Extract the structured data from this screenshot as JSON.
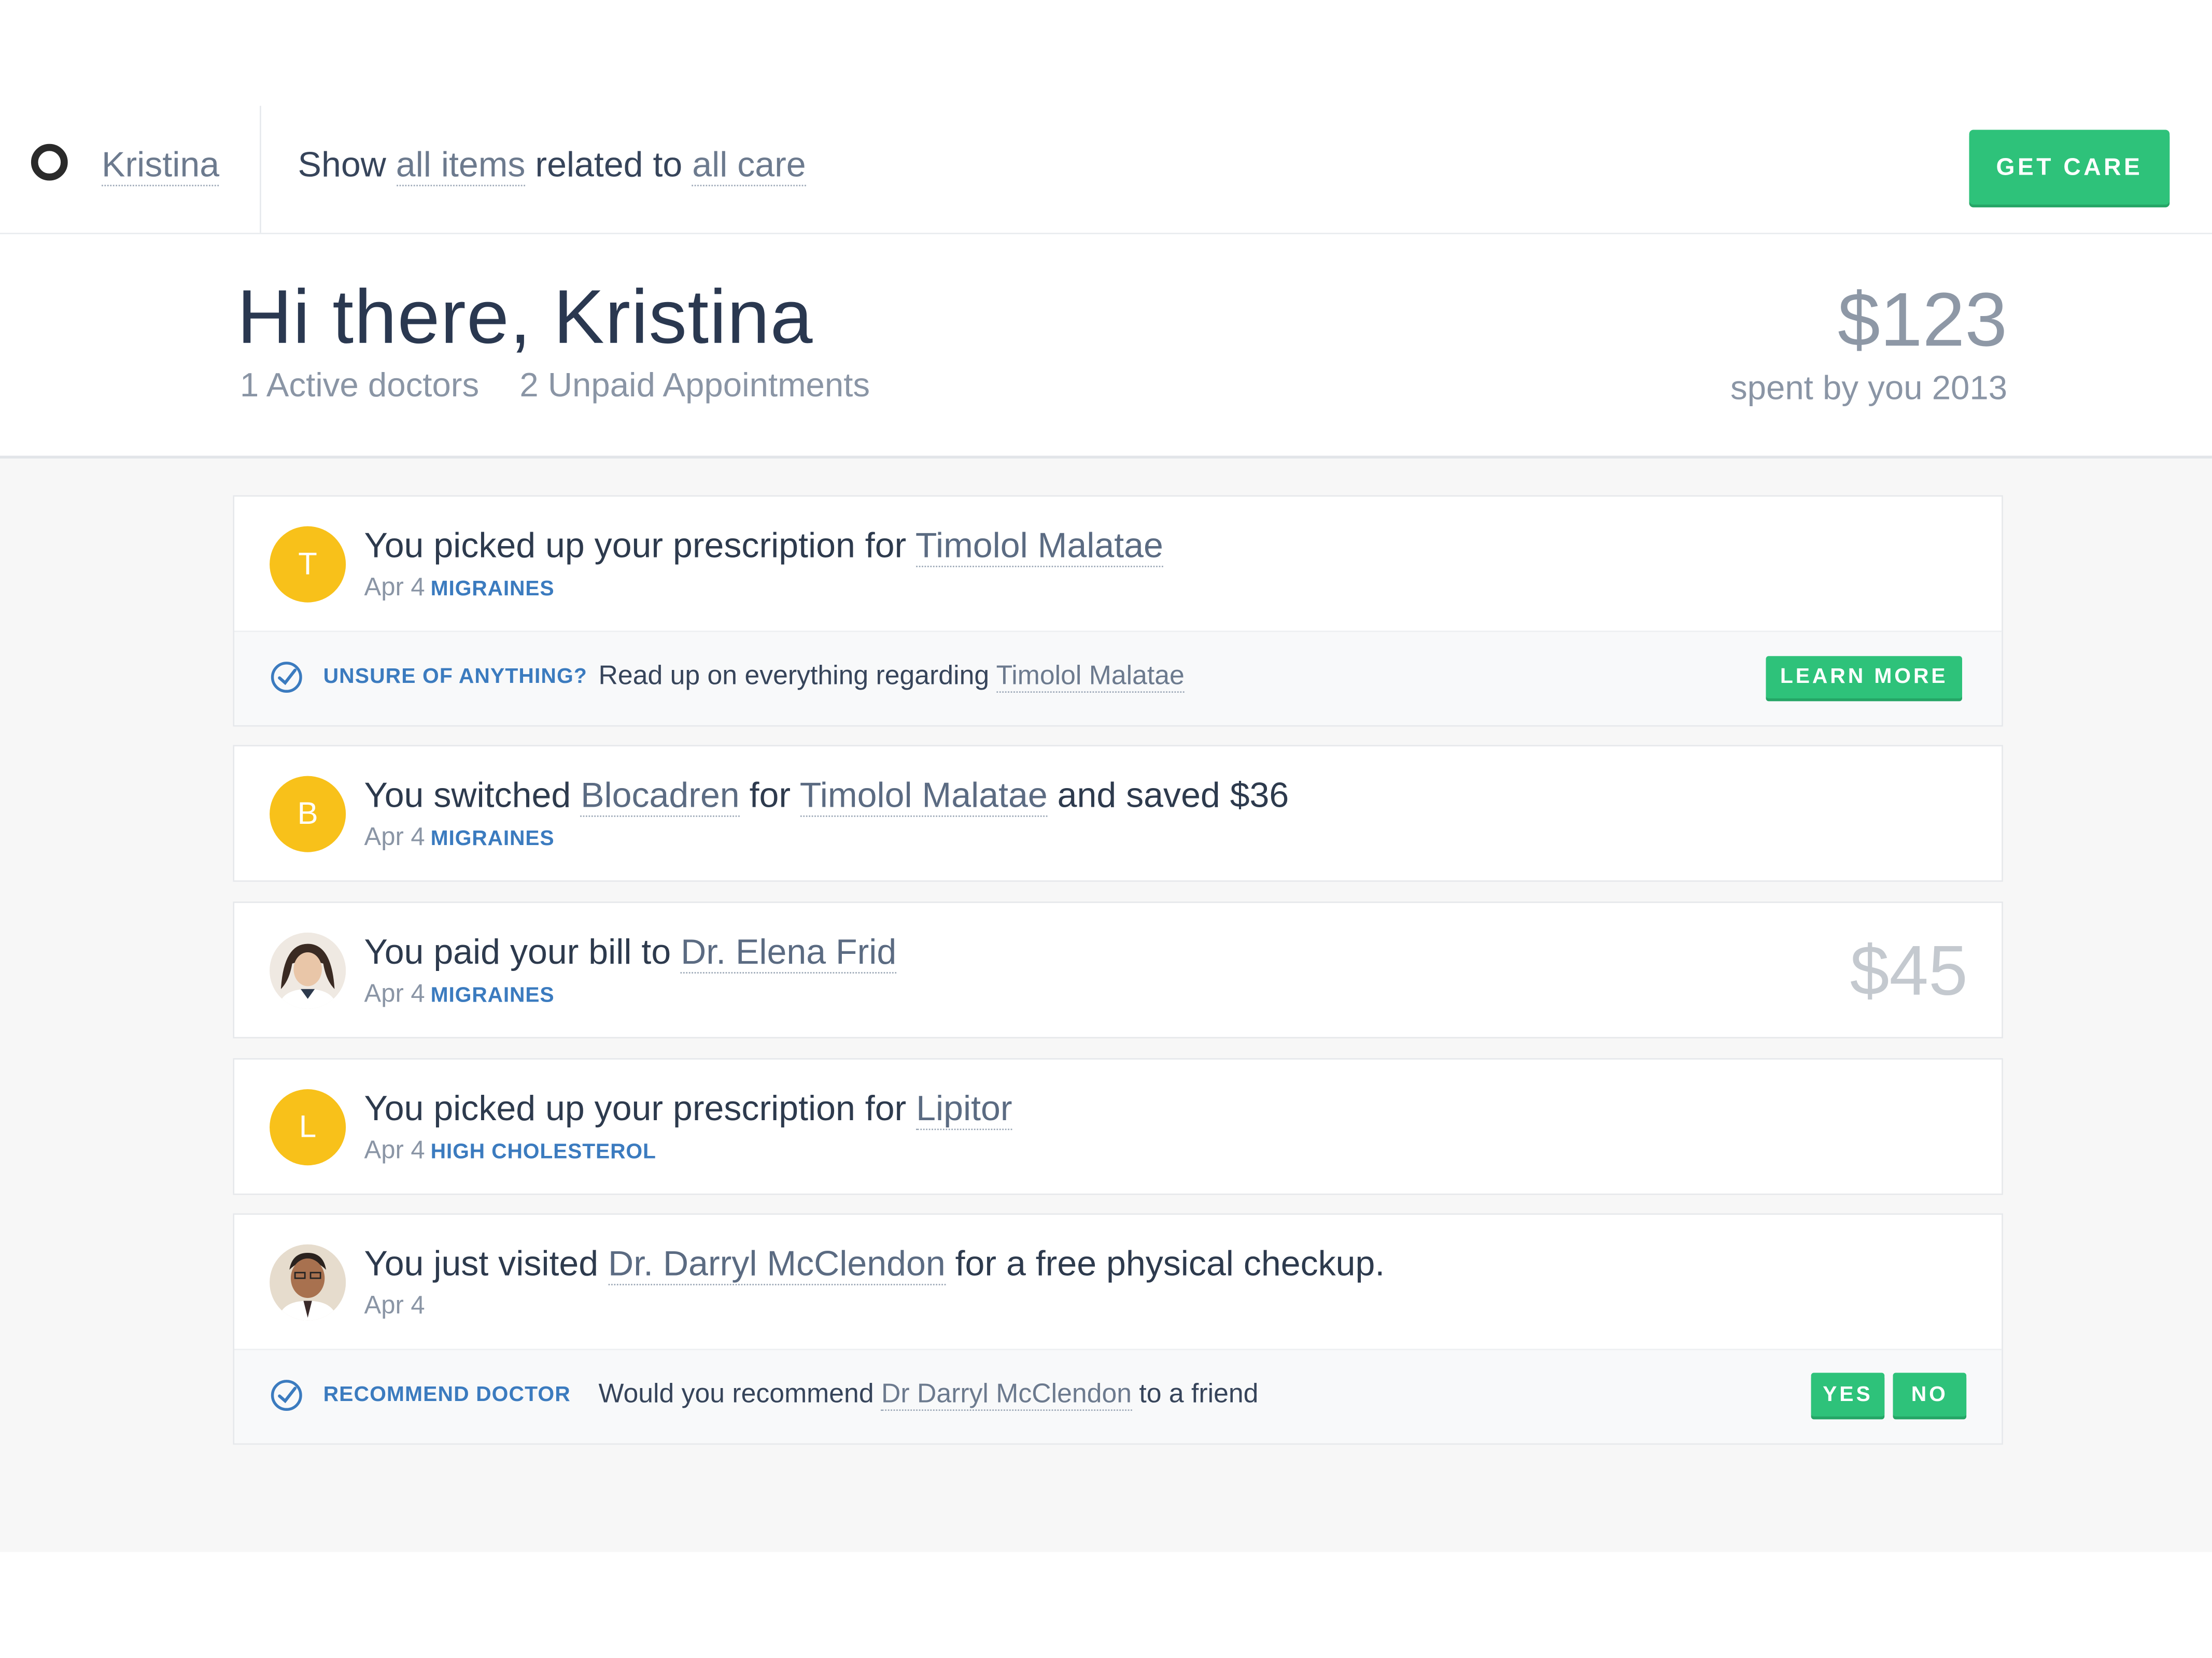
{
  "topbar": {
    "user_name": "Kristina",
    "filter": {
      "prefix": "Show",
      "items_link": "all items",
      "middle": "related to",
      "care_link": "all care"
    },
    "cta_label": "GET CARE"
  },
  "hero": {
    "greeting": "Hi there, Kristina",
    "active_doctors": "1 Active doctors",
    "unpaid": "2 Unpaid Appointments",
    "amount": "$123",
    "amount_caption": "spent by you 2013"
  },
  "feed": [
    {
      "avatar_letter": "T",
      "prefix": "You picked up your prescription for ",
      "link": "Timolol Malatae",
      "date": "Apr 4",
      "tag": "MIGRAINES",
      "footer": {
        "label": "UNSURE OF ANYTHING?",
        "text": "Read up on everything regarding ",
        "link": "Timolol Malatae",
        "button": "LEARN MORE"
      }
    },
    {
      "avatar_letter": "B",
      "prefix": "You switched ",
      "link1": "Blocadren",
      "middle": " for ",
      "link2": "Timolol Malatae",
      "suffix": " and saved $36",
      "date": "Apr 4",
      "tag": "MIGRAINES"
    },
    {
      "prefix": "You paid your bill to ",
      "link": "Dr. Elena Frid",
      "date": "Apr 4",
      "tag": "MIGRAINES",
      "amount": "$45"
    },
    {
      "avatar_letter": "L",
      "prefix": "You picked up your prescription for ",
      "link": "Lipitor",
      "date": "Apr 4",
      "tag": "HIGH CHOLESTEROL"
    },
    {
      "prefix": "You just visited ",
      "link": "Dr. Darryl McClendon",
      "suffix": " for a free physical checkup.",
      "date": "Apr 4",
      "footer": {
        "label": "RECOMMEND DOCTOR",
        "text": "Would you recommend ",
        "link": "Dr Darryl McClendon",
        "suffix": " to a friend",
        "yes": "YES",
        "no": "NO"
      }
    }
  ],
  "colors": {
    "accent_green": "#2ec27a",
    "avatar_yellow": "#f8c11a",
    "tag_blue": "#3b7bbf"
  }
}
